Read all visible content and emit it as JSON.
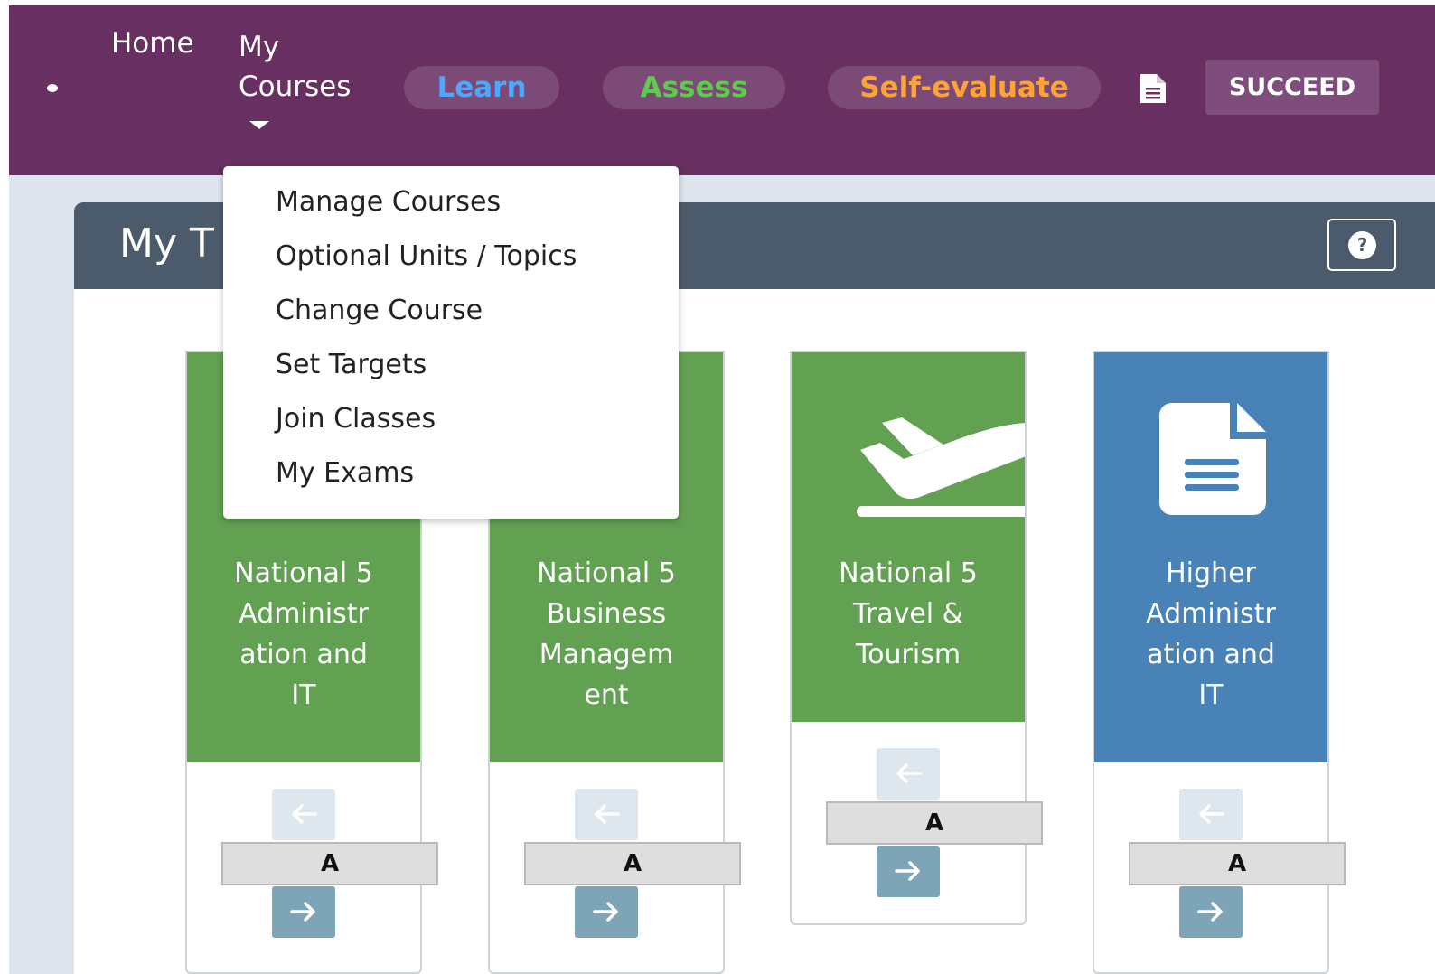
{
  "nav": {
    "home": "Home",
    "my_courses_line1": "My",
    "my_courses_line2": "Courses",
    "learn": "Learn",
    "assess": "Assess",
    "self_evaluate": "Self-evaluate",
    "succeed": "SUCCEED",
    "colors": {
      "bar": "#673060",
      "learn": "#4aa8ff",
      "assess": "#5fcb4e",
      "self_evaluate": "#ffa334"
    }
  },
  "panel": {
    "title": "My T",
    "help_icon": "?"
  },
  "dropdown": {
    "items": [
      "Manage Courses",
      "Optional Units / Topics",
      "Change Course",
      "Set Targets",
      "Join Classes",
      "My Exams"
    ]
  },
  "cards": [
    {
      "title_lines": [
        "National 5",
        "Administr",
        "ation and",
        "IT"
      ],
      "grade": "A",
      "color": "#61a151",
      "icon": "hidden-icon"
    },
    {
      "title_lines": [
        "National 5",
        "Business",
        "Managem",
        "ent"
      ],
      "grade": "A",
      "color": "#61a151",
      "icon": "hidden-icon"
    },
    {
      "title_lines": [
        "National 5",
        "Travel &",
        "Tourism"
      ],
      "grade": "A",
      "color": "#61a151",
      "icon": "plane-departure-icon"
    },
    {
      "title_lines": [
        "Higher",
        "Administr",
        "ation and",
        "IT"
      ],
      "grade": "A",
      "color": "#4882b6",
      "icon": "document-icon"
    }
  ]
}
